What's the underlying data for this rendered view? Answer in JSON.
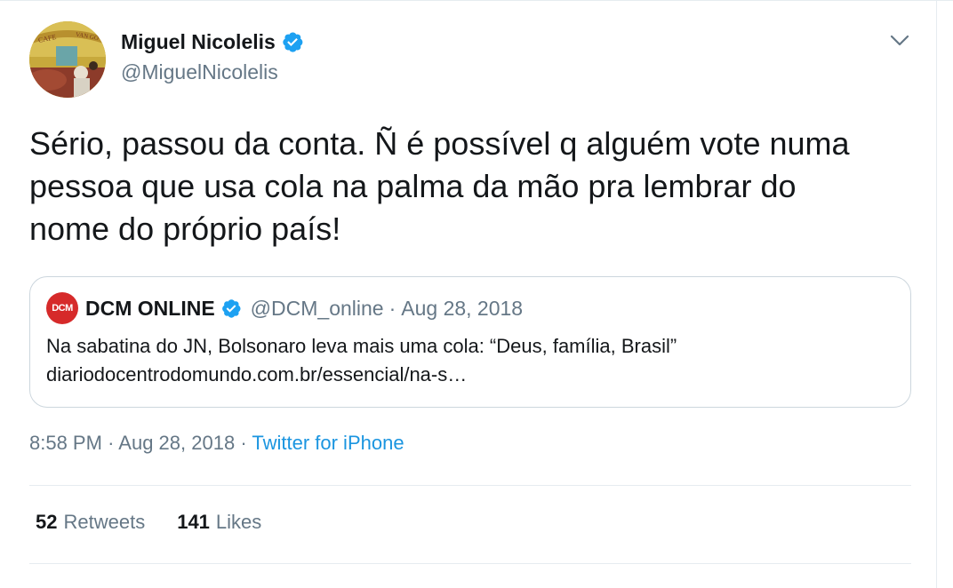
{
  "author": {
    "display_name": "Miguel Nicolelis",
    "handle": "@MiguelNicolelis",
    "verified": true,
    "avatar_icon": "avatar-photo",
    "avatar_text": "CAFÉ VAN GOGH"
  },
  "tweet": {
    "text": "Sério, passou da conta. Ñ é possível q alguém vote numa pessoa que usa cola na palma da mão pra lembrar do nome do próprio país!",
    "time": "8:58 PM",
    "date": "Aug 28, 2018",
    "source": "Twitter for iPhone",
    "separator": "·"
  },
  "quoted_tweet": {
    "logo_text": "DCM",
    "display_name": "DCM ONLINE",
    "verified": true,
    "handle": "@DCM_online",
    "separator": "·",
    "date": "Aug 28, 2018",
    "text_line1": "Na sabatina do JN, Bolsonaro leva mais uma cola: “Deus, família, Brasil”",
    "text_line2": "diariodocentrodomundo.com.br/essencial/na-s…"
  },
  "stats": {
    "retweets_count": "52",
    "retweets_label": "Retweets",
    "likes_count": "141",
    "likes_label": "Likes"
  },
  "colors": {
    "verified_blue": "#1da1f2",
    "link_blue": "#1b95e0",
    "secondary_text": "#657786",
    "primary_text": "#14171a",
    "dcm_red": "#d62a2a"
  }
}
